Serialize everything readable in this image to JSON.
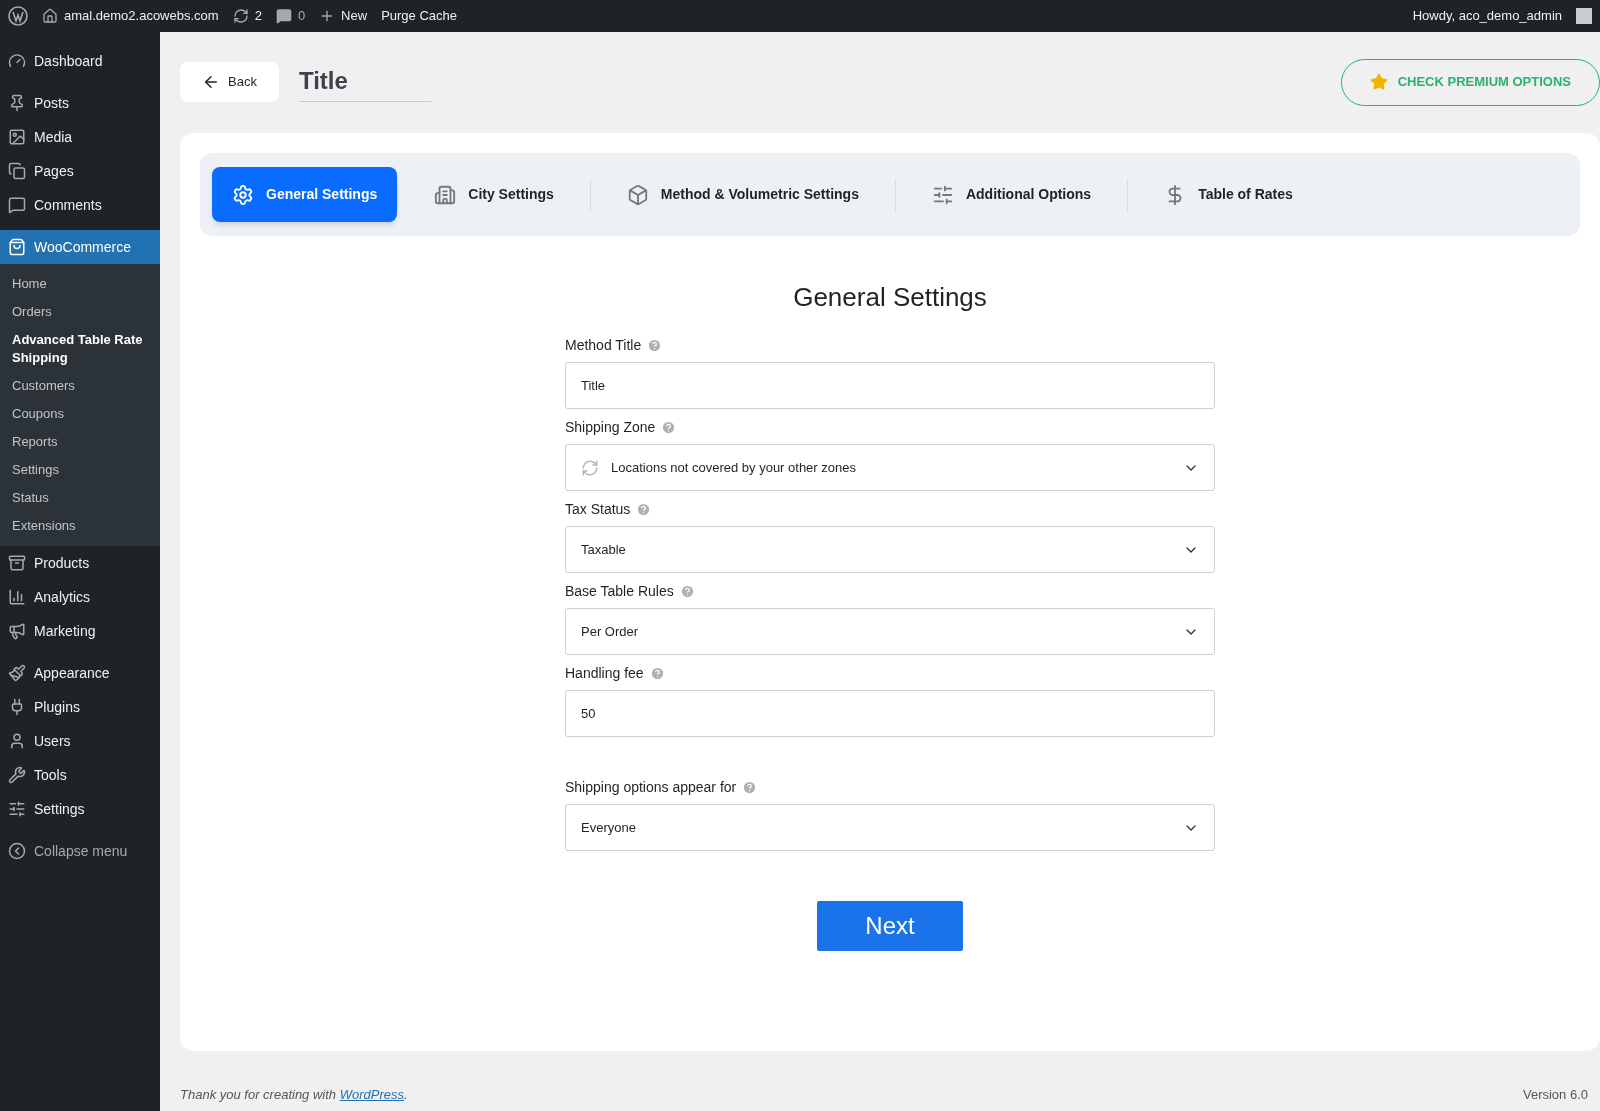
{
  "admin_bar": {
    "site": "amal.demo2.acowebs.com",
    "updates": "2",
    "comments": "0",
    "new": "New",
    "purge": "Purge Cache",
    "greeting": "Howdy, aco_demo_admin"
  },
  "sidebar": {
    "groups": [
      [
        {
          "label": "Dashboard",
          "selected": false
        }
      ],
      [
        {
          "label": "Posts",
          "selected": false
        },
        {
          "label": "Media",
          "selected": false
        },
        {
          "label": "Pages",
          "selected": false
        },
        {
          "label": "Comments",
          "selected": false
        }
      ],
      [
        {
          "label": "WooCommerce",
          "selected": true,
          "children": [
            {
              "label": "Home",
              "selected": false
            },
            {
              "label": "Orders",
              "selected": false
            },
            {
              "label": "Advanced Table Rate Shipping",
              "selected": true
            },
            {
              "label": "Customers",
              "selected": false
            },
            {
              "label": "Coupons",
              "selected": false
            },
            {
              "label": "Reports",
              "selected": false
            },
            {
              "label": "Settings",
              "selected": false
            },
            {
              "label": "Status",
              "selected": false
            },
            {
              "label": "Extensions",
              "selected": false
            }
          ]
        },
        {
          "label": "Products",
          "selected": false
        },
        {
          "label": "Analytics",
          "selected": false
        },
        {
          "label": "Marketing",
          "selected": false
        }
      ],
      [
        {
          "label": "Appearance",
          "selected": false
        },
        {
          "label": "Plugins",
          "selected": false
        },
        {
          "label": "Users",
          "selected": false
        },
        {
          "label": "Tools",
          "selected": false
        },
        {
          "label": "Settings",
          "selected": false
        }
      ],
      [
        {
          "label": "Collapse menu",
          "selected": false
        }
      ]
    ]
  },
  "header": {
    "back": "Back",
    "title": "Title",
    "premium": "CHECK PREMIUM OPTIONS"
  },
  "tabs": [
    {
      "label": "General Settings",
      "selected": true
    },
    {
      "label": "City Settings",
      "selected": false
    },
    {
      "label": "Method & Volumetric Settings",
      "selected": false
    },
    {
      "label": "Additional Options",
      "selected": false
    },
    {
      "label": "Table of Rates",
      "selected": false
    }
  ],
  "form": {
    "heading": "General Settings",
    "fields": [
      {
        "label": "Method Title",
        "kind": "input",
        "value": "Title"
      },
      {
        "label": "Shipping Zone",
        "kind": "select",
        "value": "Locations not covered by your other zones"
      },
      {
        "label": "Tax Status",
        "kind": "select",
        "value": "Taxable"
      },
      {
        "label": "Base Table Rules",
        "kind": "select",
        "value": "Per Order"
      },
      {
        "label": "Handling fee",
        "kind": "input",
        "value": "50"
      },
      {
        "label": "Shipping options appear for",
        "kind": "select",
        "value": "Everyone"
      }
    ],
    "next": "Next"
  },
  "footer": {
    "thanks": "Thank you for creating with",
    "link": "WordPress",
    "end": ".",
    "version": "Version 6.0"
  }
}
